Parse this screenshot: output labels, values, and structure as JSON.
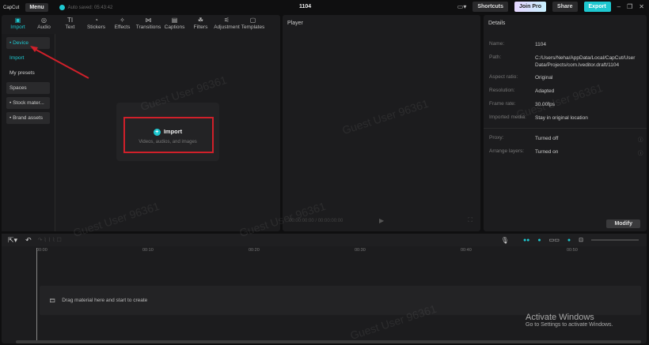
{
  "titlebar": {
    "app": "CapCut",
    "menu": "Menu",
    "autosave": "Auto saved: 05:43:42",
    "project_title": "1104",
    "shortcuts": "Shortcuts",
    "join_pro": "Join Pro",
    "share": "Share",
    "export": "Export"
  },
  "toolbar": [
    {
      "label": "Import",
      "icon": "import-icon"
    },
    {
      "label": "Audio",
      "icon": "audio-icon"
    },
    {
      "label": "Text",
      "icon": "text-icon"
    },
    {
      "label": "Stickers",
      "icon": "stickers-icon"
    },
    {
      "label": "Effects",
      "icon": "effects-icon"
    },
    {
      "label": "Transitions",
      "icon": "transitions-icon"
    },
    {
      "label": "Captions",
      "icon": "captions-icon"
    },
    {
      "label": "Filters",
      "icon": "filters-icon"
    },
    {
      "label": "Adjustment",
      "icon": "adjustment-icon"
    },
    {
      "label": "Templates",
      "icon": "templates-icon"
    }
  ],
  "sidebar": {
    "items": [
      "• Device",
      "Import",
      "My presets",
      "Spaces",
      "• Stock mater...",
      "• Brand assets"
    ]
  },
  "media": {
    "import_label": "Import",
    "import_sub": "Videos, audios, and images"
  },
  "player": {
    "title": "Player",
    "timecode": "00:00:00:00 / 00:00:00:00"
  },
  "details": {
    "title": "Details",
    "rows": [
      {
        "k": "Name:",
        "v": "1104"
      },
      {
        "k": "Path:",
        "v": "C:/Users/Neha/AppData/Local/CapCut/User Data/Projects/com.lveditor.draft/1104"
      },
      {
        "k": "Aspect ratio:",
        "v": "Original"
      },
      {
        "k": "Resolution:",
        "v": "Adapted"
      },
      {
        "k": "Frame rate:",
        "v": "30.00fps"
      },
      {
        "k": "Imported media:",
        "v": "Stay in original location"
      },
      {
        "k": "Proxy:",
        "v": "Turned off"
      },
      {
        "k": "Arrange layers:",
        "v": "Turned on"
      }
    ],
    "modify": "Modify"
  },
  "timeline": {
    "ticks": [
      "00:00",
      "00:10",
      "00:20",
      "00:30",
      "00:40",
      "00:50"
    ],
    "drag_hint": "Drag material here and start to create"
  },
  "watermark": "Guest User 96361",
  "activate": {
    "title": "Activate Windows",
    "sub": "Go to Settings to activate Windows."
  },
  "colors": {
    "accent": "#1ec8d0",
    "annotation": "#d0202a"
  }
}
